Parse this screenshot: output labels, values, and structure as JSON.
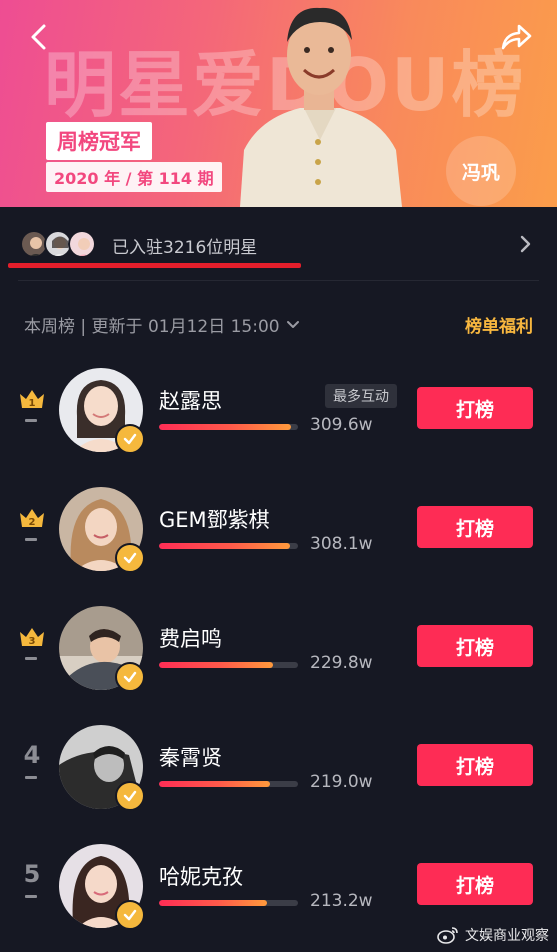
{
  "banner": {
    "title": "明星爱DOU榜",
    "champion_label": "周榜冠军",
    "period_label": "2020 年 / 第 114 期",
    "star_name": "冯巩"
  },
  "joined": {
    "text": "已入驻3216位明星"
  },
  "list_header": {
    "update_text": "本周榜 | 更新于 01月12日 15:00",
    "benefits_label": "榜单福利"
  },
  "vote_label": "打榜",
  "most_interaction_tag": "最多互动",
  "ranking": [
    {
      "rank": "1",
      "name": "赵露思",
      "score": "309.6w",
      "progress": 0.95
    },
    {
      "rank": "2",
      "name": "GEM鄧紫棋",
      "score": "308.1w",
      "progress": 0.94
    },
    {
      "rank": "3",
      "name": "费启鸣",
      "score": "229.8w",
      "progress": 0.82
    },
    {
      "rank": "4",
      "name": "秦霄贤",
      "score": "219.0w",
      "progress": 0.8
    },
    {
      "rank": "5",
      "name": "哈妮克孜",
      "score": "213.2w",
      "progress": 0.78
    }
  ],
  "watermark": "文娱商业观察",
  "colors": {
    "background": "#161823",
    "vote_button": "#fe2c55",
    "accent_gold": "#f8b73f"
  }
}
